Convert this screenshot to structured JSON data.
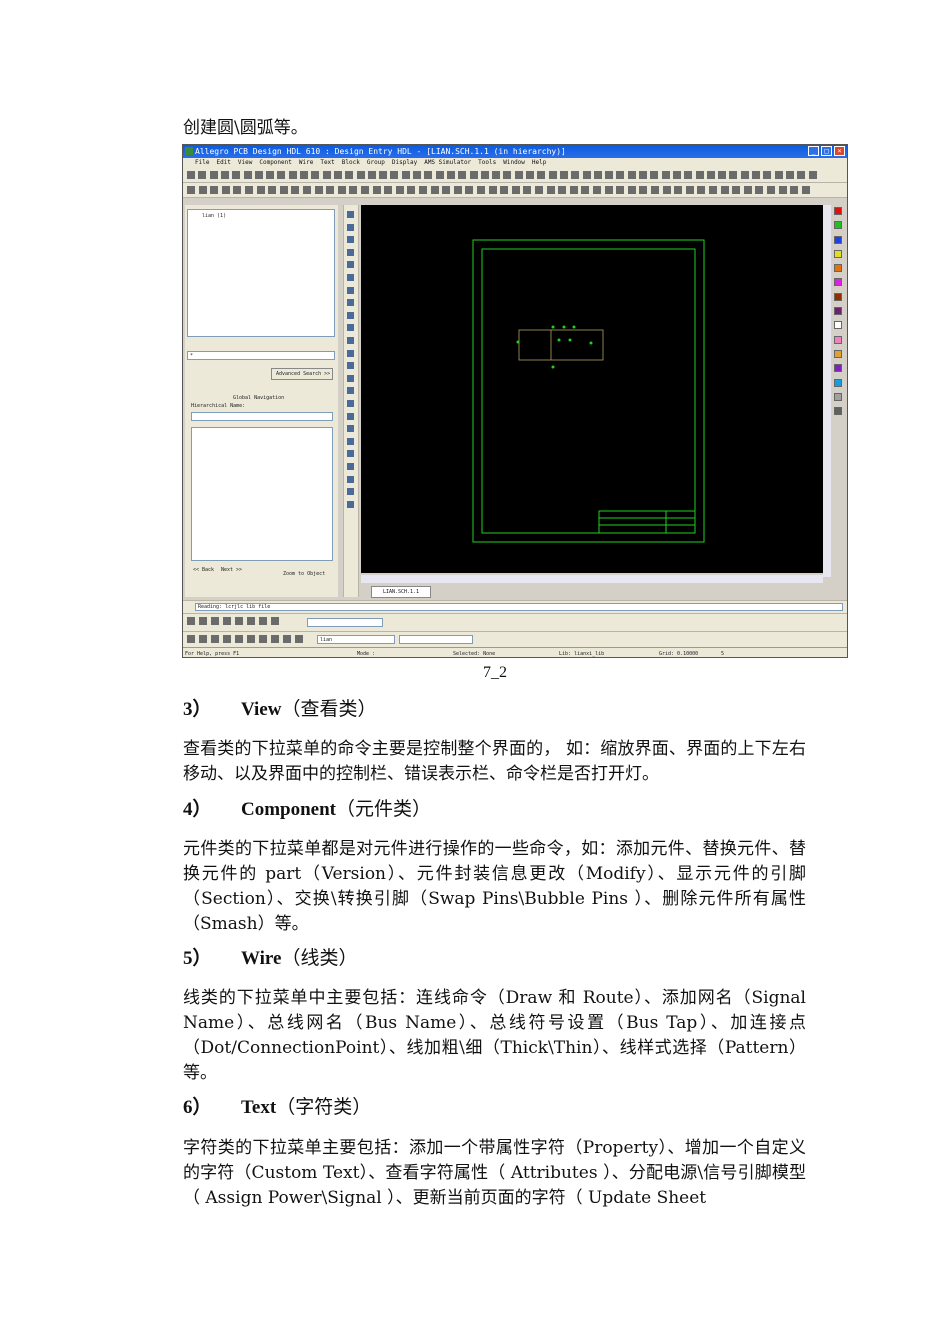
{
  "intro_text": "创建圆\\圆弧等。",
  "screenshot": {
    "window_title": "Allegro PCB Design HDL 610 : Design Entry HDL - [LIAN.SCH.1.1 (in hierarchy)]",
    "menu_items": [
      "File",
      "Edit",
      "View",
      "Component",
      "Wire",
      "Text",
      "Block",
      "Group",
      "Display",
      "AMS Simulator",
      "Tools",
      "Window",
      "Help"
    ],
    "hierarchy_root": "lian (1)",
    "search_value": "*",
    "advanced_search_label": "Advanced Search >>",
    "global_nav_title": "Global Navigation",
    "hierarchical_name_label": "Hierarchical Name:",
    "back_label": "<< Back",
    "next_label": "Next >>",
    "zoom_to_object_label": "Zoom to Object",
    "sheet_tab": "LIAN.SCH.1.1",
    "console_text": "Reading: lcrjlc lib file",
    "lib_combo_value": "lian",
    "status": {
      "help": "For Help, press F1",
      "mode": "Mode :",
      "selected": "Selected: None",
      "lib": "Lib: lianxi_lib",
      "grid": "Grid: 0.10000",
      "grid_count": "5"
    },
    "palette_colors": [
      "#e01010",
      "#20c020",
      "#2040e0",
      "#e0e020",
      "#e07010",
      "#e020e0",
      "#903000",
      "#702070",
      "#ffffff",
      "#f080c0",
      "#e0a030",
      "#8020c0",
      "#10a0e0",
      "#a0a0a0",
      "#606060"
    ]
  },
  "caption": "7_2",
  "sections": [
    {
      "num": "3）",
      "title_en": "View",
      "title_zh": "（查看类）",
      "body": "查看类的下拉菜单的命令主要是控制整个界面的， 如：缩放界面、界面的上下左右移动、以及界面中的控制栏、错误表示栏、命令栏是否打开灯。"
    },
    {
      "num": "4）",
      "title_en": "Component",
      "title_zh": "（元件类）",
      "body": "元件类的下拉菜单都是对元件进行操作的一些命令，如：添加元件、替换元件、替换元件的 part（Version）、元件封装信息更改（Modify）、显示元件的引脚（Section）、交换\\转换引脚（Swap Pins\\Bubble Pins ）、删除元件所有属性（Smash）等。"
    },
    {
      "num": "5）",
      "title_en": "Wire",
      "title_zh": "（线类）",
      "body": "线类的下拉菜单中主要包括：连线命令（Draw 和 Route）、添加网名（Signal Name）、总线网名（Bus Name）、总线符号设置（Bus Tap）、加连接点（Dot/ConnectionPoint）、线加粗\\细（Thick\\Thin）、线样式选择（Pattern）等。"
    },
    {
      "num": "6）",
      "title_en": "Text",
      "title_zh": "（字符类）",
      "body": "字符类的下拉菜单主要包括：添加一个带属性字符（Property）、增加一个自定义的字符（Custom Text）、查看字符属性（ Attributes ）、分配电源\\信号引脚模型（ Assign Power\\Signal ）、更新当前页面的字符（ Update Sheet"
    }
  ]
}
